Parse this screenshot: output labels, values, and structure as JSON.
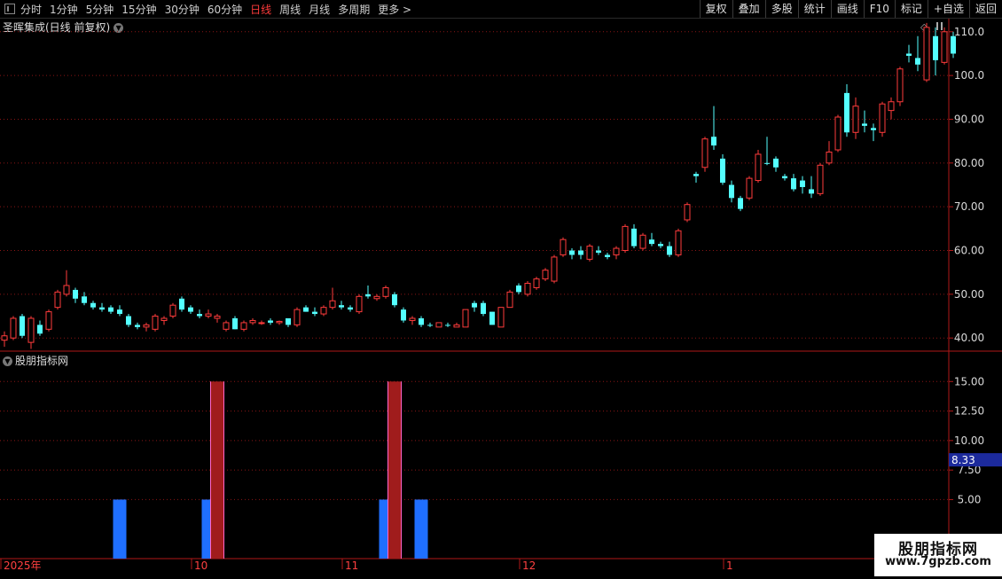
{
  "toolbar": {
    "periods": [
      "分时",
      "1分钟",
      "5分钟",
      "15分钟",
      "30分钟",
      "60分钟",
      "日线",
      "周线",
      "月线",
      "多周期",
      "更多 >"
    ],
    "active_period": "日线",
    "buttons": [
      "复权",
      "叠加",
      "多股",
      "统计",
      "画线",
      "F10",
      "标记",
      "+自选",
      "返回"
    ]
  },
  "main_title": "圣晖集成(日线 前复权)",
  "indicator_title": "股朋指标网",
  "colors": {
    "up": "#ff3b3b",
    "down": "#54ffff",
    "axis": "#b01818",
    "grid": "#8a1515",
    "bar_blue": "#1f6fff",
    "bar_red": "#a01c1c",
    "bar_pink": "#ff66cc",
    "label_bg": "#1c2a9c"
  },
  "price_axis": {
    "ticks": [
      "110.0",
      "100.0",
      "90.00",
      "80.00",
      "70.00",
      "60.00",
      "50.00",
      "40.00"
    ]
  },
  "indicator_axis": {
    "ticks": [
      "15.00",
      "12.50",
      "10.00",
      "7.50",
      "5.00"
    ],
    "current_value_label": "8.33"
  },
  "x_axis": {
    "labels": [
      "2025年",
      "10",
      "11",
      "12",
      "1"
    ]
  },
  "watermark": {
    "line1": "股朋指标网",
    "line2": "www.7gpzb.com"
  },
  "chart_data": [
    {
      "type": "candlestick",
      "y_range": [
        37,
        113
      ],
      "ticks": [
        110,
        100,
        90,
        80,
        70,
        60,
        50,
        40
      ],
      "candles": [
        {
          "o": 39.5,
          "h": 41.5,
          "l": 38,
          "c": 40.5,
          "dir": "up"
        },
        {
          "o": 40,
          "h": 45,
          "l": 39.5,
          "c": 44.5,
          "dir": "up"
        },
        {
          "o": 45,
          "h": 45.5,
          "l": 40,
          "c": 40.5,
          "dir": "down"
        },
        {
          "o": 39,
          "h": 45,
          "l": 37.5,
          "c": 44.5,
          "dir": "up"
        },
        {
          "o": 43,
          "h": 44,
          "l": 40.5,
          "c": 41,
          "dir": "down"
        },
        {
          "o": 42,
          "h": 46.5,
          "l": 41.5,
          "c": 46,
          "dir": "up"
        },
        {
          "o": 47,
          "h": 51,
          "l": 46.5,
          "c": 50.5,
          "dir": "up"
        },
        {
          "o": 50,
          "h": 55.5,
          "l": 49.5,
          "c": 52,
          "dir": "up"
        },
        {
          "o": 51,
          "h": 51.5,
          "l": 48,
          "c": 49,
          "dir": "down"
        },
        {
          "o": 49.5,
          "h": 50.5,
          "l": 47.5,
          "c": 48,
          "dir": "down"
        },
        {
          "o": 48,
          "h": 48.5,
          "l": 46.5,
          "c": 47,
          "dir": "down"
        },
        {
          "o": 47,
          "h": 48,
          "l": 46,
          "c": 46.5,
          "dir": "down"
        },
        {
          "o": 47,
          "h": 47.5,
          "l": 45.5,
          "c": 46,
          "dir": "down"
        },
        {
          "o": 46.5,
          "h": 47.5,
          "l": 45,
          "c": 45.5,
          "dir": "down"
        },
        {
          "o": 45,
          "h": 45.5,
          "l": 42.5,
          "c": 43,
          "dir": "down"
        },
        {
          "o": 43,
          "h": 43.5,
          "l": 42,
          "c": 42.5,
          "dir": "down"
        },
        {
          "o": 42.5,
          "h": 43.5,
          "l": 41.5,
          "c": 43,
          "dir": "up"
        },
        {
          "o": 42,
          "h": 45.5,
          "l": 41.5,
          "c": 45,
          "dir": "up"
        },
        {
          "o": 44,
          "h": 45,
          "l": 43,
          "c": 44.5,
          "dir": "up"
        },
        {
          "o": 45,
          "h": 48,
          "l": 44.5,
          "c": 47.5,
          "dir": "up"
        },
        {
          "o": 49,
          "h": 49.5,
          "l": 46,
          "c": 46.5,
          "dir": "down"
        },
        {
          "o": 47,
          "h": 47.5,
          "l": 45.5,
          "c": 46,
          "dir": "down"
        },
        {
          "o": 45.5,
          "h": 46.5,
          "l": 44.5,
          "c": 45,
          "dir": "down"
        },
        {
          "o": 45.5,
          "h": 46.5,
          "l": 44.5,
          "c": 45,
          "dir": "up"
        },
        {
          "o": 44.5,
          "h": 45.5,
          "l": 43.5,
          "c": 45,
          "dir": "up"
        },
        {
          "o": 42,
          "h": 44,
          "l": 41.5,
          "c": 43.5,
          "dir": "up"
        },
        {
          "o": 44.5,
          "h": 45,
          "l": 42,
          "c": 42,
          "dir": "down"
        },
        {
          "o": 42,
          "h": 44,
          "l": 41.5,
          "c": 43.5,
          "dir": "up"
        },
        {
          "o": 43.5,
          "h": 44.5,
          "l": 43,
          "c": 44,
          "dir": "up"
        },
        {
          "o": 43.5,
          "h": 44,
          "l": 43,
          "c": 43.5,
          "dir": "up"
        },
        {
          "o": 44,
          "h": 44.5,
          "l": 43,
          "c": 43.5,
          "dir": "down"
        },
        {
          "o": 43.5,
          "h": 44,
          "l": 43,
          "c": 43.8,
          "dir": "up"
        },
        {
          "o": 44.5,
          "h": 44.5,
          "l": 42.5,
          "c": 43,
          "dir": "down"
        },
        {
          "o": 43,
          "h": 47,
          "l": 42.5,
          "c": 46.5,
          "dir": "up"
        },
        {
          "o": 47,
          "h": 47.5,
          "l": 46,
          "c": 46,
          "dir": "down"
        },
        {
          "o": 46,
          "h": 47,
          "l": 45,
          "c": 45.5,
          "dir": "down"
        },
        {
          "o": 45.5,
          "h": 47.5,
          "l": 45,
          "c": 47,
          "dir": "up"
        },
        {
          "o": 47,
          "h": 51.5,
          "l": 46.5,
          "c": 48.5,
          "dir": "up"
        },
        {
          "o": 47.5,
          "h": 48.5,
          "l": 46.5,
          "c": 47,
          "dir": "down"
        },
        {
          "o": 47,
          "h": 47.5,
          "l": 46,
          "c": 46.5,
          "dir": "down"
        },
        {
          "o": 46,
          "h": 50,
          "l": 45.5,
          "c": 49.5,
          "dir": "up"
        },
        {
          "o": 50,
          "h": 52,
          "l": 49,
          "c": 49.5,
          "dir": "down"
        },
        {
          "o": 49,
          "h": 50,
          "l": 48.5,
          "c": 49.5,
          "dir": "up"
        },
        {
          "o": 49.5,
          "h": 52,
          "l": 49,
          "c": 51.5,
          "dir": "up"
        },
        {
          "o": 50,
          "h": 50.5,
          "l": 47,
          "c": 47.5,
          "dir": "down"
        },
        {
          "o": 46.5,
          "h": 47,
          "l": 43.5,
          "c": 44,
          "dir": "down"
        },
        {
          "o": 44,
          "h": 45,
          "l": 43,
          "c": 44.5,
          "dir": "up"
        },
        {
          "o": 44.5,
          "h": 45,
          "l": 42.5,
          "c": 43,
          "dir": "down"
        },
        {
          "o": 43,
          "h": 43.5,
          "l": 42.5,
          "c": 42.8,
          "dir": "down"
        },
        {
          "o": 42.5,
          "h": 43.5,
          "l": 42.5,
          "c": 43.5,
          "dir": "up"
        },
        {
          "o": 43,
          "h": 43.5,
          "l": 42.5,
          "c": 43,
          "dir": "down"
        },
        {
          "o": 42.5,
          "h": 43.5,
          "l": 42.5,
          "c": 43,
          "dir": "up"
        },
        {
          "o": 42.5,
          "h": 46.5,
          "l": 42.5,
          "c": 46.5,
          "dir": "up"
        },
        {
          "o": 48,
          "h": 48.5,
          "l": 46,
          "c": 47,
          "dir": "down"
        },
        {
          "o": 48,
          "h": 48.5,
          "l": 45,
          "c": 45.5,
          "dir": "down"
        },
        {
          "o": 46,
          "h": 46,
          "l": 43,
          "c": 43,
          "dir": "down"
        },
        {
          "o": 42.5,
          "h": 47,
          "l": 42.5,
          "c": 47,
          "dir": "up"
        },
        {
          "o": 47,
          "h": 51,
          "l": 47,
          "c": 50.5,
          "dir": "up"
        },
        {
          "o": 52,
          "h": 52.5,
          "l": 50,
          "c": 50.5,
          "dir": "down"
        },
        {
          "o": 50,
          "h": 53,
          "l": 49.5,
          "c": 52.5,
          "dir": "up"
        },
        {
          "o": 51.5,
          "h": 54,
          "l": 51,
          "c": 53.5,
          "dir": "up"
        },
        {
          "o": 53.5,
          "h": 56,
          "l": 53,
          "c": 55.5,
          "dir": "up"
        },
        {
          "o": 53,
          "h": 59,
          "l": 52.5,
          "c": 58.5,
          "dir": "up"
        },
        {
          "o": 59,
          "h": 63,
          "l": 58.5,
          "c": 62.5,
          "dir": "up"
        },
        {
          "o": 60,
          "h": 60.5,
          "l": 58,
          "c": 59,
          "dir": "down"
        },
        {
          "o": 60,
          "h": 61,
          "l": 58,
          "c": 59,
          "dir": "down"
        },
        {
          "o": 58,
          "h": 61.5,
          "l": 57.5,
          "c": 61,
          "dir": "up"
        },
        {
          "o": 60,
          "h": 61,
          "l": 59,
          "c": 59.5,
          "dir": "down"
        },
        {
          "o": 59,
          "h": 59.5,
          "l": 58,
          "c": 58.5,
          "dir": "down"
        },
        {
          "o": 59,
          "h": 61,
          "l": 58,
          "c": 60.5,
          "dir": "up"
        },
        {
          "o": 60,
          "h": 66,
          "l": 59.5,
          "c": 65.5,
          "dir": "up"
        },
        {
          "o": 65,
          "h": 66,
          "l": 60.5,
          "c": 61,
          "dir": "down"
        },
        {
          "o": 60.5,
          "h": 64,
          "l": 60,
          "c": 63.5,
          "dir": "up"
        },
        {
          "o": 62.5,
          "h": 64,
          "l": 61,
          "c": 61.5,
          "dir": "down"
        },
        {
          "o": 61.5,
          "h": 62,
          "l": 60.5,
          "c": 61,
          "dir": "down"
        },
        {
          "o": 61,
          "h": 62,
          "l": 58.5,
          "c": 59,
          "dir": "down"
        },
        {
          "o": 59,
          "h": 65,
          "l": 58.5,
          "c": 64.5,
          "dir": "up"
        },
        {
          "o": 67,
          "h": 71,
          "l": 66.5,
          "c": 70.5,
          "dir": "up"
        },
        {
          "o": 77,
          "h": 78,
          "l": 75.5,
          "c": 77.5,
          "dir": "down"
        },
        {
          "o": 79,
          "h": 86,
          "l": 78,
          "c": 85.5,
          "dir": "up"
        },
        {
          "o": 86,
          "h": 93,
          "l": 83,
          "c": 84,
          "dir": "down"
        },
        {
          "o": 81,
          "h": 82,
          "l": 75,
          "c": 75.5,
          "dir": "down"
        },
        {
          "o": 75,
          "h": 76,
          "l": 71,
          "c": 72,
          "dir": "down"
        },
        {
          "o": 72,
          "h": 72.5,
          "l": 69,
          "c": 69.5,
          "dir": "down"
        },
        {
          "o": 72,
          "h": 77,
          "l": 71.5,
          "c": 76.5,
          "dir": "up"
        },
        {
          "o": 76,
          "h": 83,
          "l": 75.5,
          "c": 82,
          "dir": "up"
        },
        {
          "o": 80,
          "h": 86,
          "l": 79.5,
          "c": 80,
          "dir": "down"
        },
        {
          "o": 81,
          "h": 81.5,
          "l": 78,
          "c": 79,
          "dir": "down"
        },
        {
          "o": 77,
          "h": 77.5,
          "l": 76,
          "c": 76.5,
          "dir": "down"
        },
        {
          "o": 76.5,
          "h": 77.5,
          "l": 73.5,
          "c": 74,
          "dir": "down"
        },
        {
          "o": 76,
          "h": 77,
          "l": 73,
          "c": 74.5,
          "dir": "down"
        },
        {
          "o": 74,
          "h": 77,
          "l": 72,
          "c": 73,
          "dir": "down"
        },
        {
          "o": 73,
          "h": 80,
          "l": 72.5,
          "c": 79.5,
          "dir": "up"
        },
        {
          "o": 80,
          "h": 85,
          "l": 79.5,
          "c": 82.5,
          "dir": "up"
        },
        {
          "o": 83,
          "h": 91,
          "l": 82.5,
          "c": 90.5,
          "dir": "up"
        },
        {
          "o": 96,
          "h": 98,
          "l": 86,
          "c": 87,
          "dir": "down"
        },
        {
          "o": 87,
          "h": 95,
          "l": 85.5,
          "c": 93,
          "dir": "up"
        },
        {
          "o": 89,
          "h": 92,
          "l": 87,
          "c": 88.5,
          "dir": "down"
        },
        {
          "o": 88,
          "h": 89,
          "l": 85,
          "c": 87.5,
          "dir": "down"
        },
        {
          "o": 87,
          "h": 94,
          "l": 86,
          "c": 93.5,
          "dir": "up"
        },
        {
          "o": 92,
          "h": 95,
          "l": 90,
          "c": 94,
          "dir": "up"
        },
        {
          "o": 94,
          "h": 102,
          "l": 93,
          "c": 101.5,
          "dir": "up"
        },
        {
          "o": 105,
          "h": 107,
          "l": 103,
          "c": 104.5,
          "dir": "down"
        },
        {
          "o": 104,
          "h": 109,
          "l": 101,
          "c": 102.5,
          "dir": "down"
        },
        {
          "o": 99,
          "h": 112,
          "l": 98.5,
          "c": 111,
          "dir": "up"
        },
        {
          "o": 109,
          "h": 111,
          "l": 100,
          "c": 103.5,
          "dir": "down"
        },
        {
          "o": 103,
          "h": 111,
          "l": 102.5,
          "c": 110,
          "dir": "up"
        },
        {
          "o": 109,
          "h": 110,
          "l": 104,
          "c": 105,
          "dir": "down"
        }
      ]
    },
    {
      "type": "bar",
      "y_range": [
        0,
        17.5
      ],
      "ticks": [
        15,
        12.5,
        10,
        7.5,
        5
      ],
      "series": [
        {
          "color_key": "bar_blue",
          "candle_index": 13,
          "value": 5
        },
        {
          "color_key": "bar_blue",
          "candle_index": 23,
          "value": 5
        },
        {
          "color_key": "bar_red",
          "candle_index": 24,
          "value": 15
        },
        {
          "color_key": "bar_blue",
          "candle_index": 43,
          "value": 5
        },
        {
          "color_key": "bar_red",
          "candle_index": 44,
          "value": 15
        },
        {
          "color_key": "bar_blue",
          "candle_index": 47,
          "value": 5
        }
      ],
      "current_value": 8.33
    }
  ]
}
